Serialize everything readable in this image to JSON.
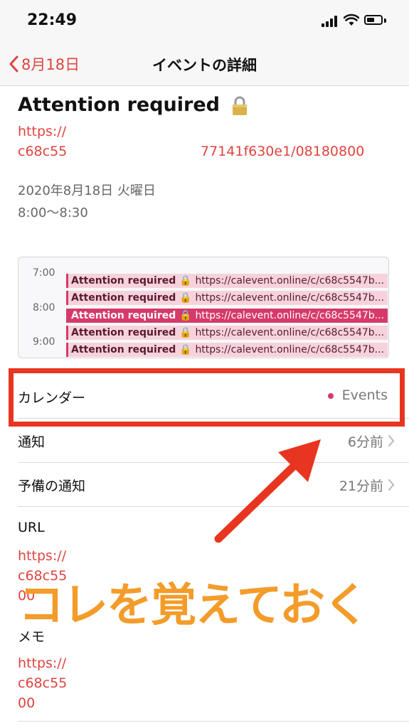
{
  "status_bar": {
    "time": "22:49"
  },
  "nav": {
    "back_label": "8月18日",
    "title": "イベントの詳細"
  },
  "event": {
    "title": "Attention required",
    "url_line1": "https://",
    "url_line2": "c68c55",
    "url_line2_end": "77141f630e1/08180800",
    "date": "2020年8月18日 火曜日",
    "time_range": "8:00〜8:30"
  },
  "mini_calendar": {
    "hours": [
      "7:00",
      "8:00",
      "9:00"
    ],
    "events": [
      {
        "title": "Attention required",
        "url": "https://calevent.online/c/c68c5547b...",
        "selected": false
      },
      {
        "title": "Attention required",
        "url": "https://calevent.online/c/c68c5547b...",
        "selected": false
      },
      {
        "title": "Attention required",
        "url": "https://calevent.online/c/c68c5547b...",
        "selected": true
      },
      {
        "title": "Attention required",
        "url": "https://calevent.online/c/c68c5547b...",
        "selected": false
      },
      {
        "title": "Attention required",
        "url": "https://calevent.online/c/c68c5547b...",
        "selected": false
      }
    ]
  },
  "rows": {
    "calendar": {
      "label": "カレンダー",
      "value": "Events"
    },
    "alert": {
      "label": "通知",
      "value": "6分前"
    },
    "second_alert": {
      "label": "予備の通知",
      "value": "21分前"
    }
  },
  "url_section": {
    "label": "URL",
    "line1": "https://",
    "line2": "c68c55",
    "line3": "00"
  },
  "memo_section": {
    "label": "メモ",
    "line1": "https://",
    "line2": "c68c55",
    "line3": "00"
  },
  "annotation": {
    "text": "コレを覚えておく"
  },
  "colors": {
    "accent_red": "#e0443e",
    "calendar_pink": "#d63a6a",
    "highlight_red": "#e8351f",
    "annotation_orange": "#f39c2a"
  }
}
